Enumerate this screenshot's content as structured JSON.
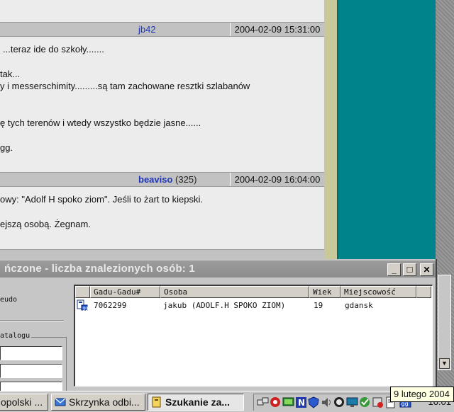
{
  "forum": {
    "post1": {
      "author": "jb42",
      "date": "2004-02-09 15:31:00",
      "lines": [
        "...teraz ide do szkoły.......",
        "tak...",
        "y i messerschimity.........są tam zachowane resztki szlabanów",
        "ę tych terenów i wtedy wszystko będzie jasne......",
        "gg."
      ]
    },
    "post2": {
      "author": "beaviso",
      "count": "(325)",
      "date": "2004-02-09 16:04:00",
      "lines": [
        "owy: \"Adolf H spoko ziom\". Jeśli to żart to kiepski.",
        "ejszą osobą. Żegnam."
      ]
    }
  },
  "dialog": {
    "title": "ńczone - liczba znalezionych osób: 1",
    "minimize_label": "_",
    "maximize_label": "□",
    "close_label": "✕",
    "left_panel": {
      "pseudo_label": "eudo",
      "catalog_label": "atalogu"
    },
    "results": {
      "columns": [
        "Gadu-Gadu#",
        "Osoba",
        "Wiek",
        "Miejscowość"
      ],
      "rows": [
        {
          "number": "7062299",
          "person": "jakub (ADOLF.H SPOKO ZIOM)",
          "age": "19",
          "city": "gdansk"
        }
      ]
    }
  },
  "taskbar": {
    "tasks": [
      {
        "label": "opolski ..."
      },
      {
        "label": "Skrzynka odbi..."
      },
      {
        "label": "Szukanie za..."
      }
    ],
    "clock": "16:01",
    "tooltip": "9 lutego 2004"
  },
  "colors": {
    "teal": "#00838a",
    "link_blue": "#1f36b8",
    "tooltip_bg": "#ffffe1"
  }
}
